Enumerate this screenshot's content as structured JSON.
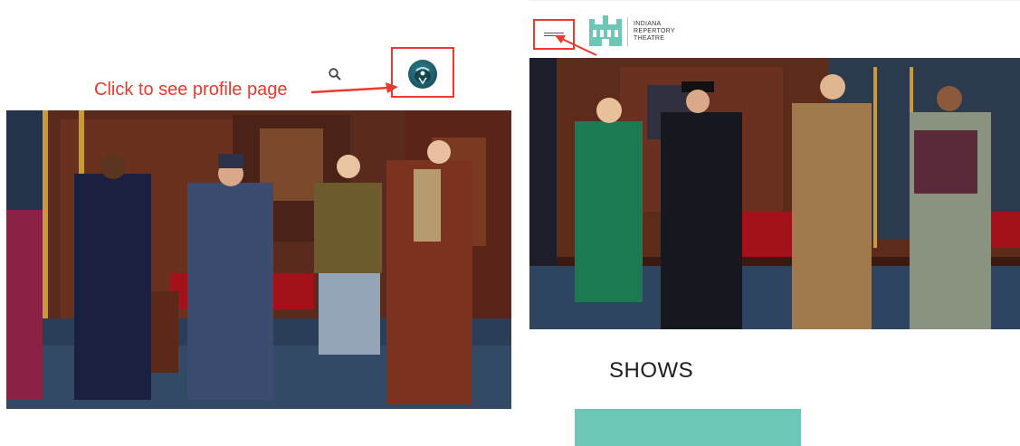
{
  "annotation": {
    "profile_hint": "Click to see profile page"
  },
  "right_panel": {
    "logo_lines": [
      "INDIANA",
      "REPERTORY",
      "THEATRE"
    ],
    "section_heading": "SHOWS"
  },
  "colors": {
    "annotation_red": "#e63b2e",
    "brand_teal": "#6dc7b7",
    "avatar_teal": "#2f7f8c"
  },
  "icons": [
    "search-icon",
    "avatar",
    "menu-icon",
    "irt-logo"
  ]
}
